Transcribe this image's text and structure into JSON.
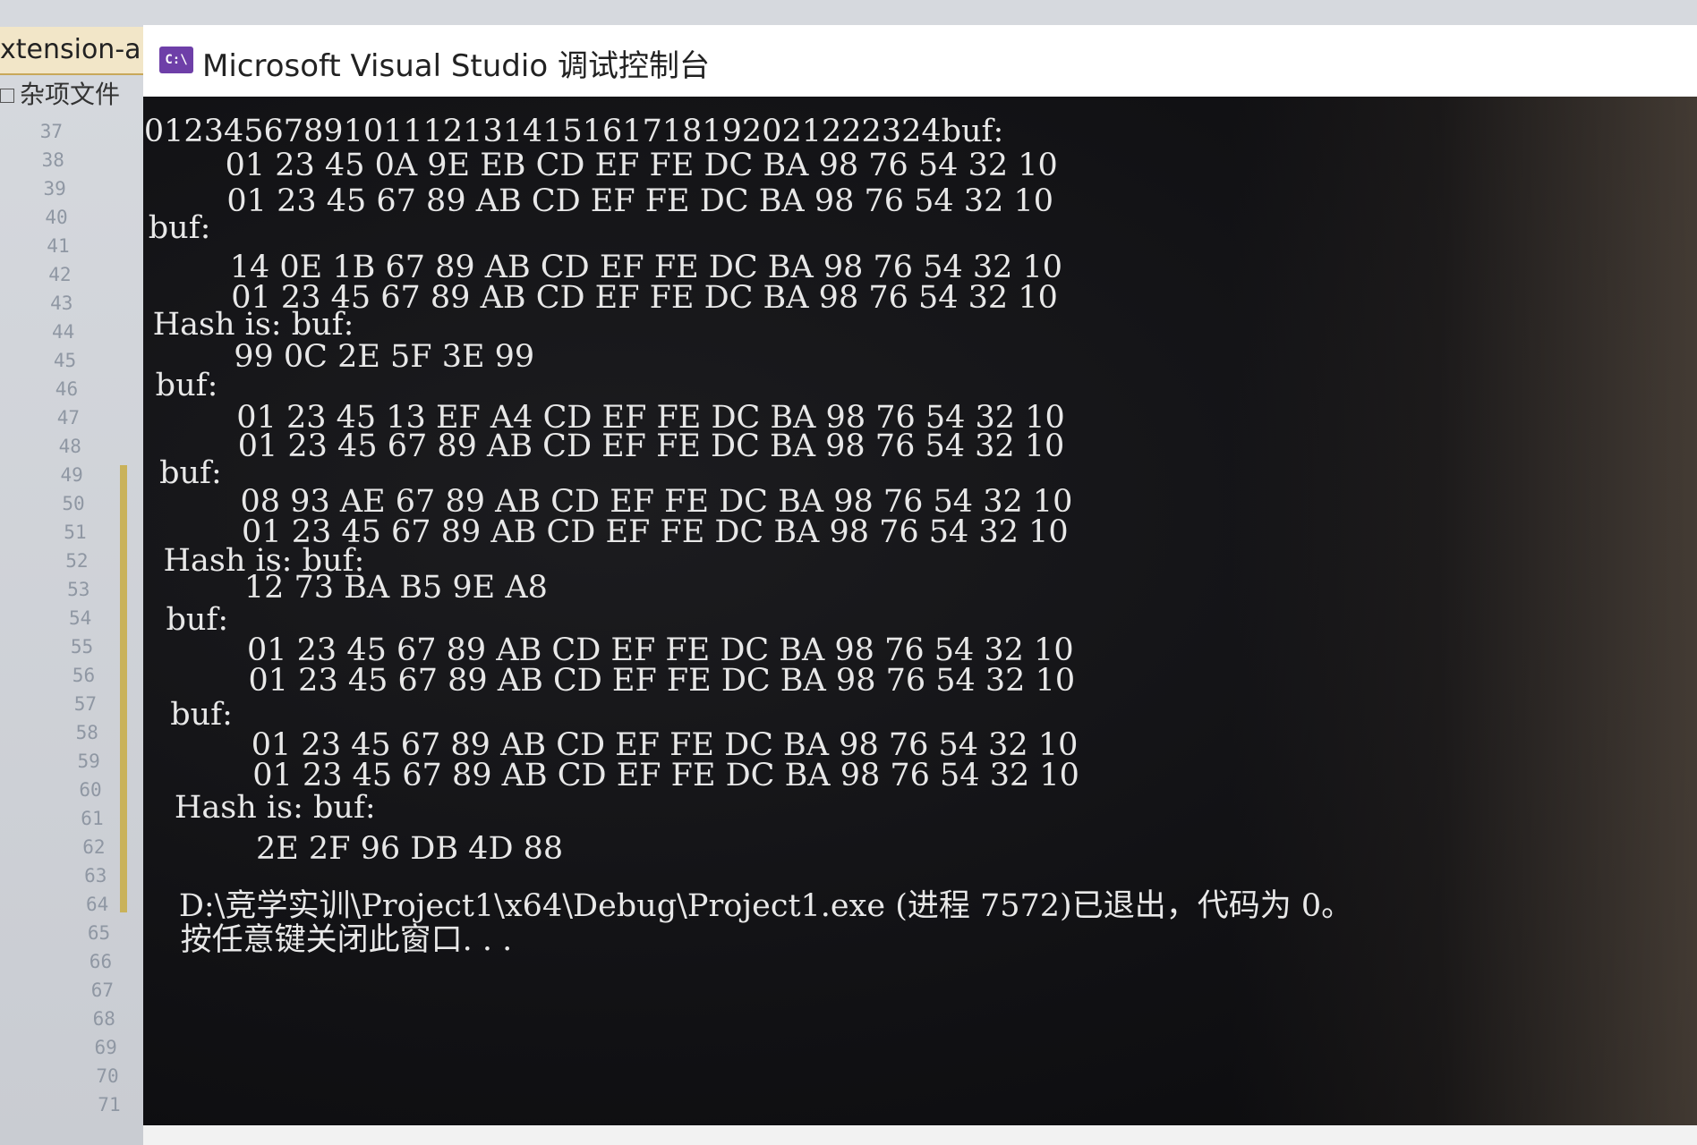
{
  "editor": {
    "tab_label": "xtension-a",
    "file_label": "杂项文件",
    "line_numbers": [
      "37",
      "38",
      "39",
      "40",
      "41",
      "42",
      "43",
      "44",
      "45",
      "46",
      "47",
      "48",
      "49",
      "50",
      "51",
      "52",
      "53",
      "54",
      "55",
      "56",
      "57",
      "58",
      "59",
      "60",
      "61",
      "62",
      "63",
      "64",
      "65",
      "66",
      "67",
      "68",
      "69",
      "70",
      "71"
    ]
  },
  "console": {
    "title": "Microsoft Visual Studio 调试控制台",
    "icon_label": "C:\\",
    "lines": [
      "0123456789101112131415161718192021222324buf:",
      "        01 23 45 0A 9E EB CD EF FE DC BA 98 76 54 32 10",
      "        01 23 45 67 89 AB CD EF FE DC BA 98 76 54 32 10",
      "buf:",
      "        14 0E 1B 67 89 AB CD EF FE DC BA 98 76 54 32 10",
      "        01 23 45 67 89 AB CD EF FE DC BA 98 76 54 32 10",
      "Hash is: buf:",
      "        99 0C 2E 5F 3E 99",
      "buf:",
      "        01 23 45 13 EF A4 CD EF FE DC BA 98 76 54 32 10",
      "        01 23 45 67 89 AB CD EF FE DC BA 98 76 54 32 10",
      "buf:",
      "        08 93 AE 67 89 AB CD EF FE DC BA 98 76 54 32 10",
      "        01 23 45 67 89 AB CD EF FE DC BA 98 76 54 32 10",
      "Hash is: buf:",
      "        12 73 BA B5 9E A8",
      "buf:",
      "        01 23 45 67 89 AB CD EF FE DC BA 98 76 54 32 10",
      "        01 23 45 67 89 AB CD EF FE DC BA 98 76 54 32 10",
      "buf:",
      "        01 23 45 67 89 AB CD EF FE DC BA 98 76 54 32 10",
      "        01 23 45 67 89 AB CD EF FE DC BA 98 76 54 32 10",
      "Hash is: buf:",
      "        2E 2F 96 DB 4D 88",
      "",
      "D:\\竞学实训\\Project1\\x64\\Debug\\Project1.exe (进程 7572)已退出，代码为 0。",
      "按任意键关闭此窗口. . ."
    ]
  }
}
